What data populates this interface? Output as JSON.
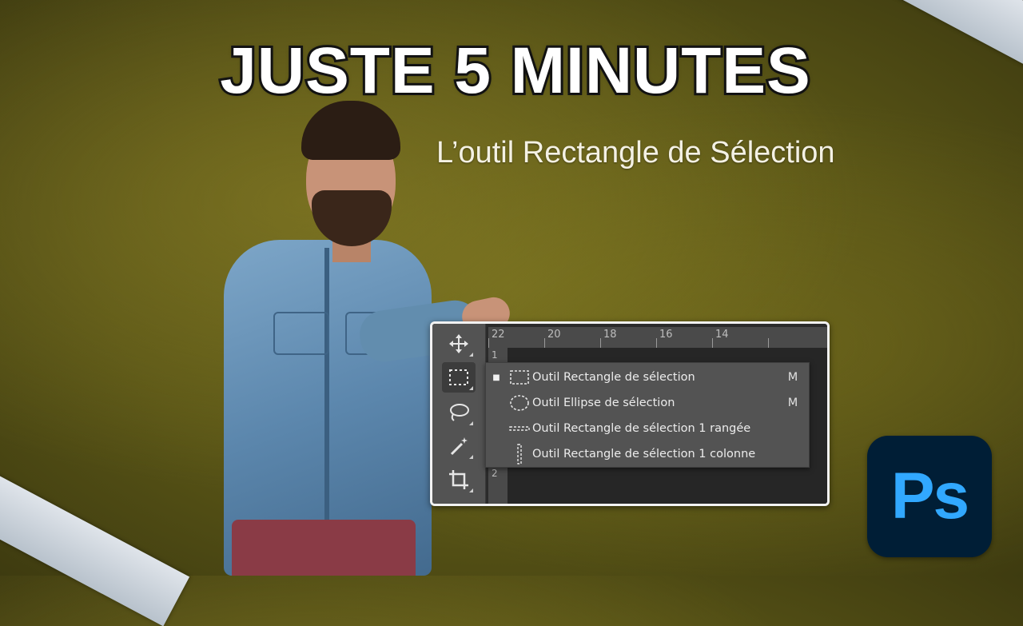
{
  "thumbnail": {
    "headline": "JUSTE 5 MINUTES",
    "subtitle": "L’outil Rectangle de Sélection"
  },
  "photoshop": {
    "ruler_top": [
      "22",
      "20",
      "18",
      "16",
      "14"
    ],
    "ruler_left": [
      "1",
      "2"
    ],
    "toolbar": [
      {
        "icon": "move-tool-icon",
        "active": false
      },
      {
        "icon": "rectangular-marquee-icon",
        "active": true
      },
      {
        "icon": "lasso-icon",
        "active": false
      },
      {
        "icon": "magic-wand-icon",
        "active": false
      },
      {
        "icon": "crop-icon",
        "active": false
      }
    ],
    "flyout": [
      {
        "label": "Outil Rectangle de sélection",
        "shortcut": "M",
        "selected": true,
        "icon": "rectangular-marquee-icon"
      },
      {
        "label": "Outil Ellipse de sélection",
        "shortcut": "M",
        "selected": false,
        "icon": "elliptical-marquee-icon"
      },
      {
        "label": "Outil Rectangle de sélection 1 rangée",
        "shortcut": "",
        "selected": false,
        "icon": "single-row-marquee-icon"
      },
      {
        "label": "Outil Rectangle de sélection 1 colonne",
        "shortcut": "",
        "selected": false,
        "icon": "single-column-marquee-icon"
      }
    ],
    "logo_text": "Ps",
    "colors": {
      "panel": "#535353",
      "canvas": "#262626",
      "logo_bg": "#001e36",
      "logo_fg": "#31a8ff"
    }
  }
}
